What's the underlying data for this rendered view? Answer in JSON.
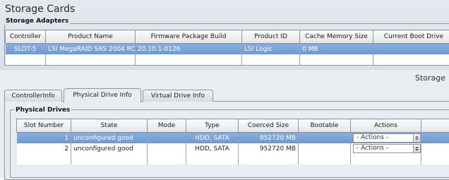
{
  "page_title": "Storage Cards",
  "adapters": {
    "legend": "Storage Adapters",
    "columns": [
      "Controller",
      "Product Name",
      "Firmware Package Build",
      "Product ID",
      "Cache Memory Size",
      "Current Boot Drive"
    ],
    "rows": [
      [
        "SLOT-5",
        "LSI MegaRAID SAS 2004 RC",
        "20.10.1-0126",
        "LSI Logic",
        "0 MB",
        ""
      ]
    ]
  },
  "storage_label": "Storage",
  "tabs": [
    "ControllerInfo",
    "Physical Drive Info",
    "Virtual Drive Info"
  ],
  "active_tab": "Physical Drive Info",
  "drives": {
    "legend": "Physical Drives",
    "columns": [
      "Slot Number",
      "State",
      "Mode",
      "Type",
      "Coerced Size",
      "Bootable",
      "Actions",
      ""
    ],
    "rows": [
      {
        "slot": "1",
        "state": "unconfigured good",
        "mode": "",
        "type": "HDD, SATA",
        "size": "952720 MB",
        "bootable": "",
        "action": "- Actions -"
      },
      {
        "slot": "2",
        "state": "unconfigured good",
        "mode": "",
        "type": "HDD, SATA",
        "size": "952720 MB",
        "bootable": "",
        "action": "- Actions -"
      }
    ]
  },
  "colors": {
    "selected_row": "#7aa3d9",
    "panel_bg": "#e8edf1"
  },
  "icons": {
    "actions_dropdown": "spinner-arrows-icon"
  }
}
